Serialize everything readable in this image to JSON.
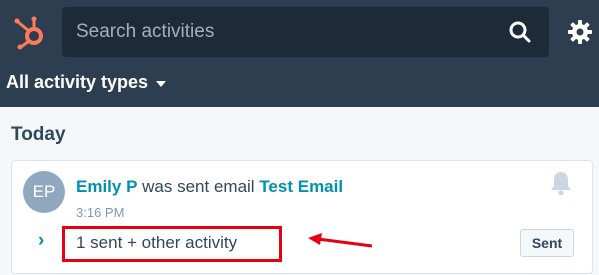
{
  "header": {
    "search": {
      "placeholder": "Search activities"
    },
    "filter": {
      "label": "All activity types"
    }
  },
  "section": {
    "title": "Today"
  },
  "activity": {
    "avatar_initials": "EP",
    "actor": "Emily P",
    "action_text": " was sent email ",
    "email_name": "Test Email",
    "time": "3:16 PM",
    "summary": "1 sent + other activity",
    "status_button": "Sent"
  },
  "colors": {
    "header_bg": "#2d3e50",
    "search_bg": "#1d2b38",
    "link": "#0091ae",
    "annotation": "#e60012",
    "logo": "#ff7a59"
  },
  "icons": [
    "hubspot-logo-icon",
    "search-icon",
    "gear-icon",
    "bell-icon",
    "chevron-right-icon",
    "arrow-annotation-icon"
  ]
}
